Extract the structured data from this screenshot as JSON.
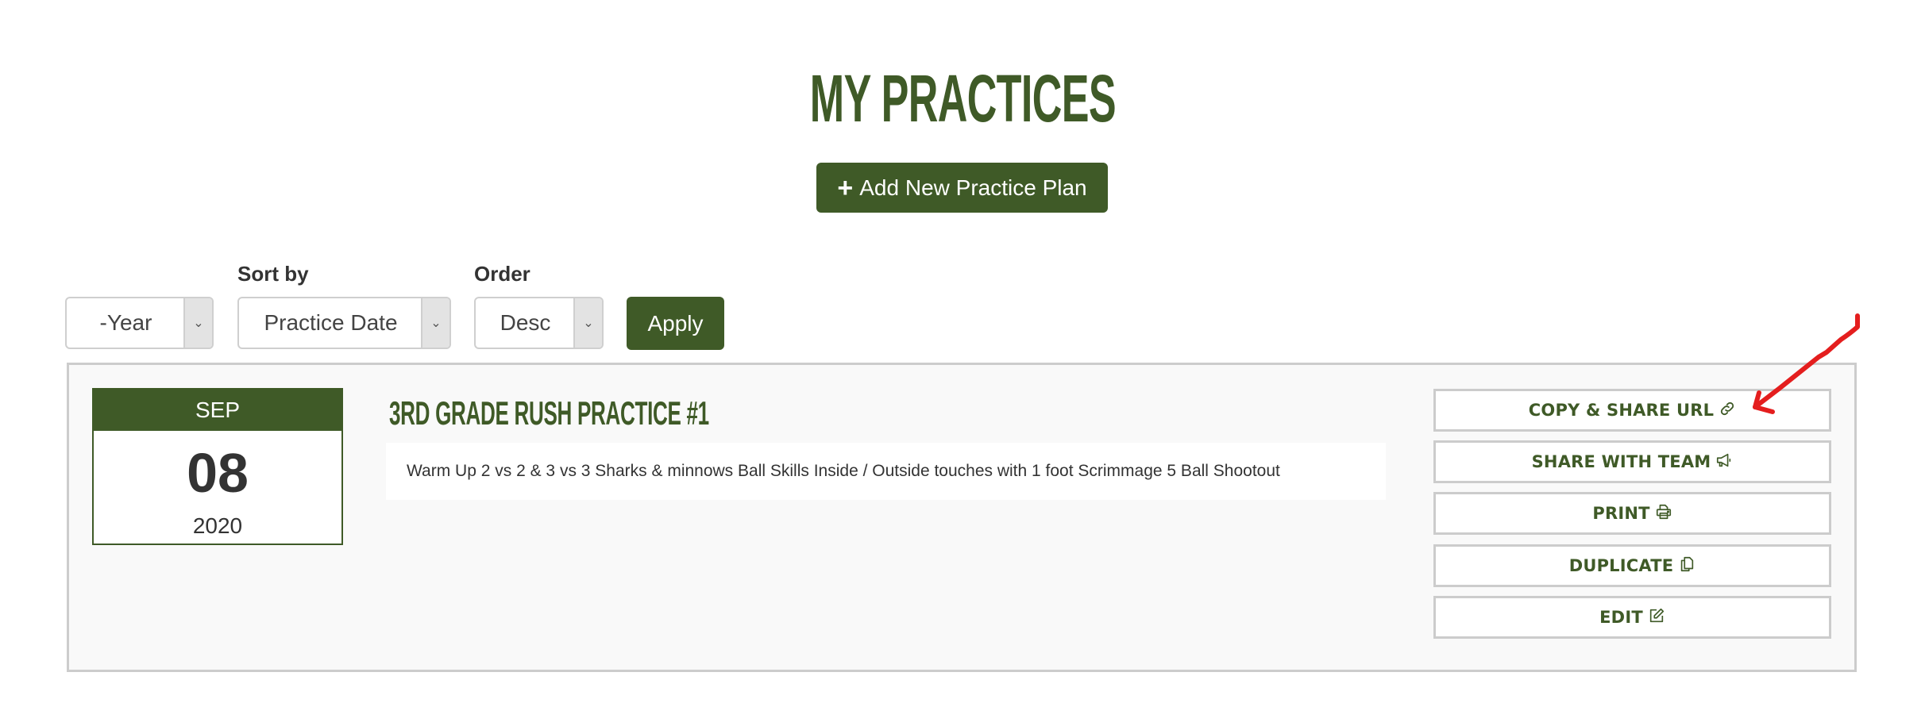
{
  "header": {
    "title": "MY PRACTICES",
    "add_button": {
      "icon": "plus-icon",
      "label": "Add New Practice Plan"
    }
  },
  "filters": {
    "year": {
      "label": "",
      "value": "-Year"
    },
    "sort_by": {
      "label": "Sort by",
      "value": "Practice Date"
    },
    "order": {
      "label": "Order",
      "value": "Desc"
    },
    "apply_label": "Apply",
    "dropdown_icon": "chevron-down-icon"
  },
  "practices": [
    {
      "date": {
        "month": "SEP",
        "day": "08",
        "year": "2020"
      },
      "title": "3RD GRADE RUSH PRACTICE #1",
      "description": "Warm Up 2 vs 2 & 3 vs 3 Sharks & minnows Ball Skills Inside / Outside touches with 1 foot Scrimmage 5 Ball Shootout",
      "actions": [
        {
          "label": "COPY & SHARE URL",
          "icon": "link-icon"
        },
        {
          "label": "SHARE WITH TEAM",
          "icon": "megaphone-icon"
        },
        {
          "label": "PRINT",
          "icon": "printer-icon"
        },
        {
          "label": "DUPLICATE",
          "icon": "copy-icon"
        },
        {
          "label": "EDIT",
          "icon": "edit-icon"
        }
      ]
    }
  ],
  "annotation": {
    "type": "red-arrow",
    "points_to": "COPY & SHARE URL",
    "color": "#e41e1e"
  },
  "colors": {
    "brand_green": "#3f5a27",
    "card_bg": "#f9f9f9",
    "border_gray": "#cccccc"
  }
}
